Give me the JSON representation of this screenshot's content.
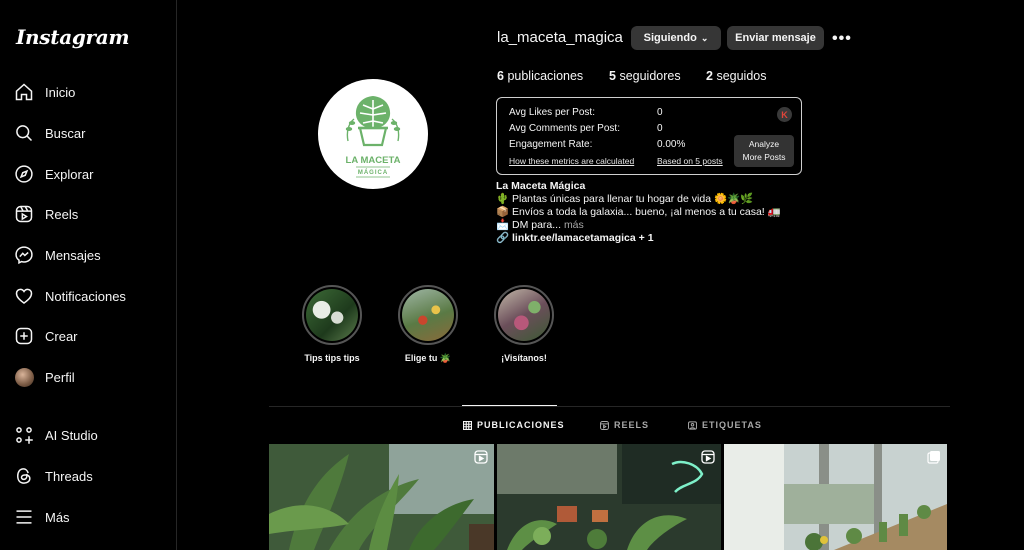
{
  "app": {
    "logo": "Instagram"
  },
  "sidebar": {
    "items": [
      {
        "label": "Inicio",
        "icon": "home-icon"
      },
      {
        "label": "Buscar",
        "icon": "search-icon"
      },
      {
        "label": "Explorar",
        "icon": "compass-icon"
      },
      {
        "label": "Reels",
        "icon": "reels-icon"
      },
      {
        "label": "Mensajes",
        "icon": "messenger-icon"
      },
      {
        "label": "Notificaciones",
        "icon": "heart-icon"
      },
      {
        "label": "Crear",
        "icon": "plus-square-icon"
      },
      {
        "label": "Perfil",
        "icon": "profile-avatar"
      },
      {
        "label": "AI Studio",
        "icon": "ai-studio-icon"
      },
      {
        "label": "Threads",
        "icon": "threads-icon"
      },
      {
        "label": "Más",
        "icon": "menu-icon"
      }
    ]
  },
  "profile": {
    "username": "la_maceta_magica",
    "follow_label": "Siguiendo",
    "message_label": "Enviar mensaje",
    "more_label": "•••",
    "logo_text_top": "LA MACETA",
    "logo_text_bottom": "MÁGICA",
    "stats": {
      "posts_count": "6",
      "posts_label": "publicaciones",
      "followers_count": "5",
      "followers_label": "seguidores",
      "following_count": "2",
      "following_label": "seguidos"
    },
    "bio": {
      "name": "La Maceta Mágica",
      "line1": "🌵 Plantas únicas para llenar tu hogar de vida 🌼🪴🌿",
      "line2": "📦 Envíos a toda la galaxia... bueno, ¡al menos a tu casa! 🚛",
      "line3_prefix": "📩 DM para...",
      "line3_more": "más",
      "link": "linktr.ee/lamacetamagica + 1"
    }
  },
  "metrics": {
    "avg_likes_label": "Avg Likes per Post:",
    "avg_likes_value": "0",
    "avg_comments_label": "Avg Comments per Post:",
    "avg_comments_value": "0",
    "engagement_label": "Engagement Rate:",
    "engagement_value": "0.00%",
    "how_link": "How these metrics are calculated",
    "based_link": "Based on 5 posts",
    "analyze_line1": "Analyze",
    "analyze_line2": "More Posts",
    "badge_letter": "K"
  },
  "highlights": [
    {
      "label": "Tips tips tips"
    },
    {
      "label": "Elige tu 🪴"
    },
    {
      "label": "¡Visítanos!"
    }
  ],
  "tabs": [
    {
      "label": "PUBLICACIONES",
      "icon": "grid-icon",
      "active": true
    },
    {
      "label": "REELS",
      "icon": "reels-tab-icon",
      "active": false
    },
    {
      "label": "ETIQUETAS",
      "icon": "tagged-icon",
      "active": false
    }
  ],
  "colors": {
    "background": "#000000",
    "button": "#363636",
    "brand_green": "#6cb26a"
  }
}
